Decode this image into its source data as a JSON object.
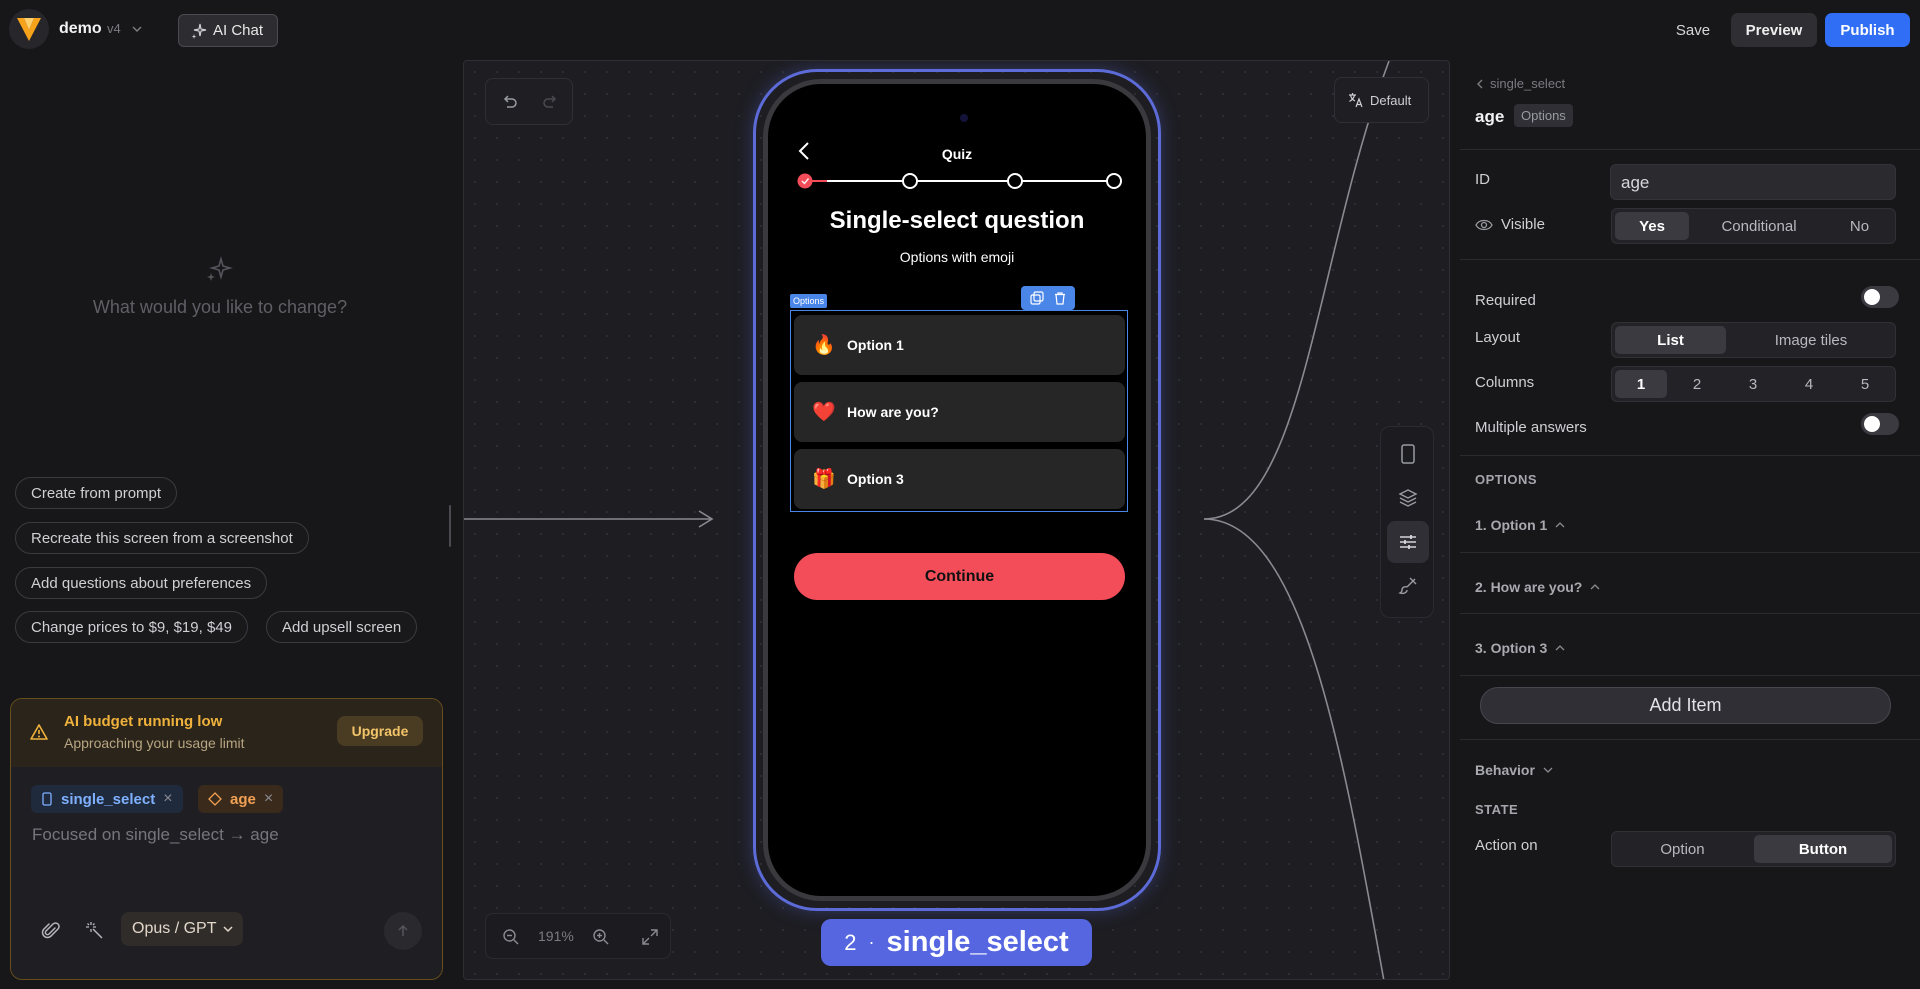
{
  "header": {
    "project_name": "demo",
    "project_version": "v4",
    "ai_chat_label": "AI Chat",
    "save_label": "Save",
    "preview_label": "Preview",
    "publish_label": "Publish"
  },
  "left_panel": {
    "prompt_placeholder": "What would you like to change?",
    "suggestions": [
      "Create from prompt",
      "Recreate this screen from a screenshot",
      "Add questions about preferences",
      "Change prices to $9, $19, $49",
      "Add upsell screen"
    ],
    "budget": {
      "title": "AI budget running low",
      "subtitle": "Approaching your usage limit",
      "upgrade_label": "Upgrade"
    },
    "context_tags": [
      {
        "label": "single_select"
      },
      {
        "label": "age"
      }
    ],
    "focus_text": "Focused on single_select → age",
    "model_label": "Opus / GPT"
  },
  "canvas": {
    "language_label": "Default",
    "zoom_level": "191%",
    "screen_number": "2",
    "screen_name": "single_select",
    "phone": {
      "header_title": "Quiz",
      "question_title": "Single-select question",
      "question_subtitle": "Options with emoji",
      "options_badge": "Options",
      "options": [
        {
          "emoji": "🔥",
          "label": "Option 1"
        },
        {
          "emoji": "❤️",
          "label": "How are you?"
        },
        {
          "emoji": "🎁",
          "label": "Option 3"
        }
      ],
      "continue_label": "Continue",
      "progress": {
        "steps": 4,
        "completed": 1
      }
    }
  },
  "right_panel": {
    "breadcrumb": "single_select",
    "title": "age",
    "badge": "Options",
    "id_label": "ID",
    "id_value": "age",
    "visible_label": "Visible",
    "visible_options": [
      "Yes",
      "Conditional",
      "No"
    ],
    "visible_selected": "Yes",
    "required_label": "Required",
    "required_on": false,
    "layout_label": "Layout",
    "layout_options": [
      "List",
      "Image tiles"
    ],
    "layout_selected": "List",
    "columns_label": "Columns",
    "columns_options": [
      "1",
      "2",
      "3",
      "4",
      "5"
    ],
    "columns_selected": "1",
    "multiple_label": "Multiple answers",
    "multiple_on": false,
    "options_heading": "OPTIONS",
    "option_rows": [
      "1. Option 1",
      "2. How are you?",
      "3. Option 3"
    ],
    "add_item_label": "Add Item",
    "behavior_label": "Behavior",
    "state_heading": "STATE",
    "action_on_label": "Action on",
    "action_on_options": [
      "Option",
      "Button"
    ],
    "action_on_selected": "Button"
  },
  "colors": {
    "accent_blue": "#2f6ef5",
    "phone_outline": "#5d6bd8",
    "continue_red": "#f34d5a",
    "budget_orange": "#f0b23c"
  }
}
